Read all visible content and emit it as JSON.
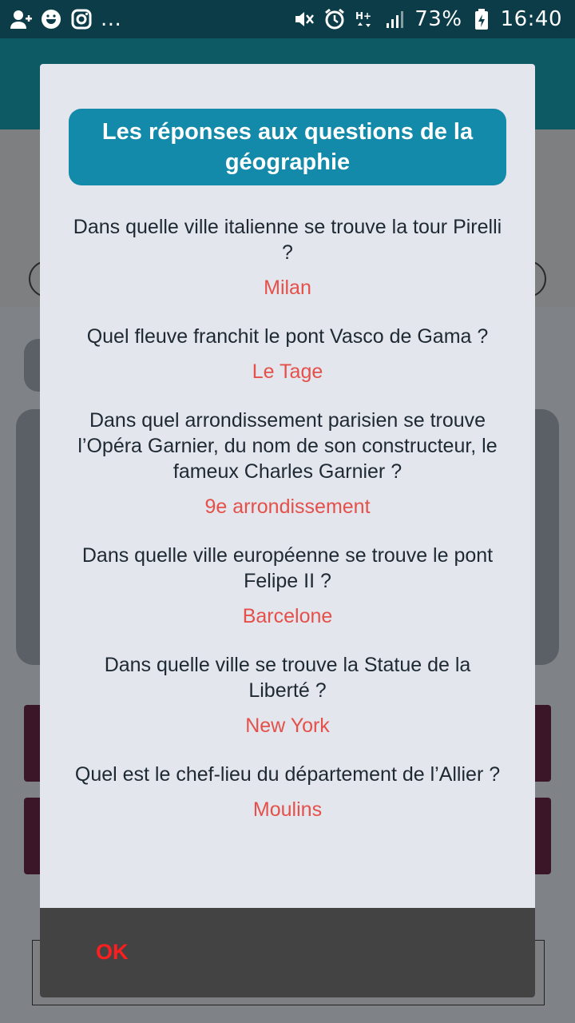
{
  "status_bar": {
    "left_icons": [
      "add-contact-icon",
      "smiley-icon",
      "instagram-icon"
    ],
    "overflow": "...",
    "right_icons": [
      "mute-icon",
      "alarm-icon",
      "hplus-icon",
      "signal-icon",
      "battery-icon"
    ],
    "network": "H+",
    "battery": "73%",
    "time": "16:40"
  },
  "dialog": {
    "title": "Les réponses aux questions de la géographie",
    "items": [
      {
        "question": "Dans quelle ville italienne se trouve la tour Pirelli ?",
        "answer": "Milan"
      },
      {
        "question": "Quel fleuve franchit le pont Vasco de Gama ?",
        "answer": "Le Tage"
      },
      {
        "question": "Dans quel arrondissement parisien se trouve l’Opéra Garnier, du nom de son constructeur, le fameux Charles Garnier ?",
        "answer": "9e arrondissement"
      },
      {
        "question": "Dans quelle ville européenne se trouve le pont Felipe II ?",
        "answer": "Barcelone"
      },
      {
        "question": "Dans quelle ville se trouve la Statue de la Liberté ?",
        "answer": "New York"
      },
      {
        "question": "Quel est le chef-lieu du département de l’Allier ?",
        "answer": "Moulins"
      }
    ],
    "ok_label": "OK"
  },
  "colors": {
    "title_bg": "#148aaa",
    "answer": "#e5504a",
    "ok": "#ff1e1e",
    "footer": "#434343"
  }
}
